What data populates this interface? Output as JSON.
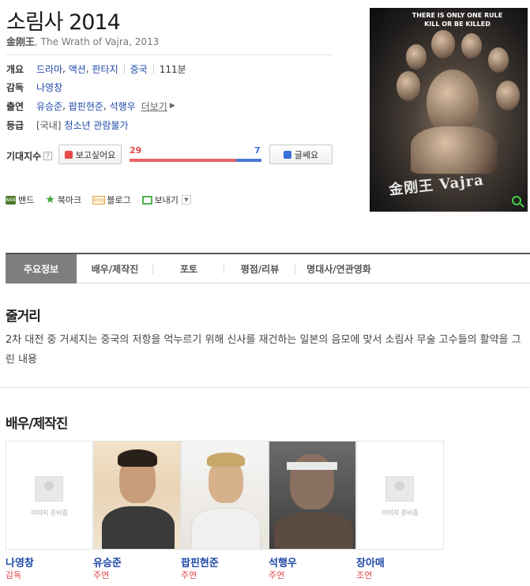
{
  "title": "소림사 2014",
  "subtitle": {
    "hanzi": "金刚王",
    "rest": ", The Wrath of Vajra, 2013"
  },
  "info": {
    "overview_label": "개요",
    "genres": [
      "드라마",
      "액션",
      "판타지"
    ],
    "country": "중국",
    "runtime": "111분",
    "director_label": "감독",
    "director": "나영창",
    "cast_label": "출연",
    "cast": [
      "유승준",
      "팝핀현준",
      "석행우"
    ],
    "more_label": "더보기",
    "rating_label": "등급",
    "rating_region": "[국내]",
    "rating_value": "청소년 관람불가"
  },
  "expectation": {
    "label": "기대지수",
    "help": "?",
    "want_label": "보고싶어요",
    "meh_label": "글쎄요",
    "want_count": "29",
    "meh_count": "7",
    "want_ratio": 0.806
  },
  "share": {
    "band": "밴드",
    "bookmark": "북마크",
    "blog": "블로그",
    "send": "보내기"
  },
  "poster": {
    "tagline_line1": "THERE IS ONLY ONE RULE",
    "tagline_line2": "KILL OR BE KILLED",
    "logo_text": "金刚王 Vajra"
  },
  "tabs": [
    "주요정보",
    "배우/제작진",
    "포토",
    "평점/리뷰",
    "명대사/연관영화"
  ],
  "synopsis": {
    "title": "줄거리",
    "text": "2차 대전 중 거세지는 중국의 저항을 억누르기 위해 신사를 재건하는 일본의 음모에 맞서 소림사 무술 고수들의 활약을 그린 내용"
  },
  "cast_section": {
    "title": "배우/제작진",
    "placeholder": "이미지 준비중",
    "members": [
      {
        "name": "나영창",
        "role": "감독"
      },
      {
        "name": "유승준",
        "role": "주연"
      },
      {
        "name": "팝핀현준",
        "role": "주연"
      },
      {
        "name": "석행우",
        "role": "주연"
      },
      {
        "name": "장아매",
        "role": "조연"
      }
    ]
  },
  "colors": {
    "link": "#1f4aa8",
    "want": "#e86464",
    "meh": "#4a79d8",
    "active_tab": "#7e7e7e"
  }
}
